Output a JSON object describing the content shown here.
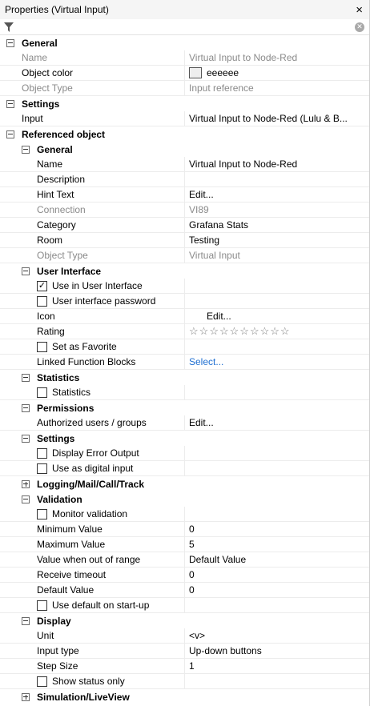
{
  "window": {
    "title": "Properties (Virtual Input)",
    "close": "×"
  },
  "filter": {
    "value": ""
  },
  "general": {
    "header": "General",
    "name_label": "Name",
    "name_value": "Virtual Input to Node-Red",
    "color_label": "Object color",
    "color_value": "eeeeee",
    "color_hex": "#eeeeee",
    "type_label": "Object Type",
    "type_value": "Input reference"
  },
  "settings": {
    "header": "Settings",
    "input_label": "Input",
    "input_value": "Virtual Input to Node-Red (Lulu & B..."
  },
  "ref": {
    "header": "Referenced object",
    "general": {
      "header": "General",
      "name_label": "Name",
      "name_value": "Virtual Input to Node-Red",
      "desc_label": "Description",
      "desc_value": "",
      "hint_label": "Hint Text",
      "hint_value": "Edit...",
      "conn_label": "Connection",
      "conn_value": "VI89",
      "cat_label": "Category",
      "cat_value": "Grafana Stats",
      "room_label": "Room",
      "room_value": "Testing",
      "type_label": "Object Type",
      "type_value": "Virtual Input"
    },
    "ui": {
      "header": "User Interface",
      "use_ui": "Use in User Interface",
      "ui_pw": "User interface password",
      "icon_label": "Icon",
      "icon_value": "Edit...",
      "rating_label": "Rating",
      "rating_stars": 10,
      "favorite": "Set as Favorite",
      "linked_label": "Linked Function Blocks",
      "linked_value": "Select..."
    },
    "statistics": {
      "header": "Statistics",
      "stat_label": "Statistics"
    },
    "permissions": {
      "header": "Permissions",
      "auth_label": "Authorized users / groups",
      "auth_value": "Edit..."
    },
    "settings": {
      "header": "Settings",
      "err_label": "Display Error Output",
      "digital_label": "Use as digital input"
    },
    "logging": {
      "header": "Logging/Mail/Call/Track"
    },
    "validation": {
      "header": "Validation",
      "monitor_label": "Monitor validation",
      "min_label": "Minimum Value",
      "min_value": "0",
      "max_label": "Maximum Value",
      "max_value": "5",
      "oor_label": "Value when out of range",
      "oor_value": "Default Value",
      "timeout_label": "Receive timeout",
      "timeout_value": "0",
      "default_label": "Default Value",
      "default_value": "0",
      "use_default_label": "Use default on start-up"
    },
    "display": {
      "header": "Display",
      "unit_label": "Unit",
      "unit_value": "<v>",
      "input_type_label": "Input type",
      "input_type_value": "Up-down buttons",
      "step_label": "Step Size",
      "step_value": "1",
      "status_label": "Show status only"
    },
    "simulation": {
      "header": "Simulation/LiveView"
    }
  }
}
